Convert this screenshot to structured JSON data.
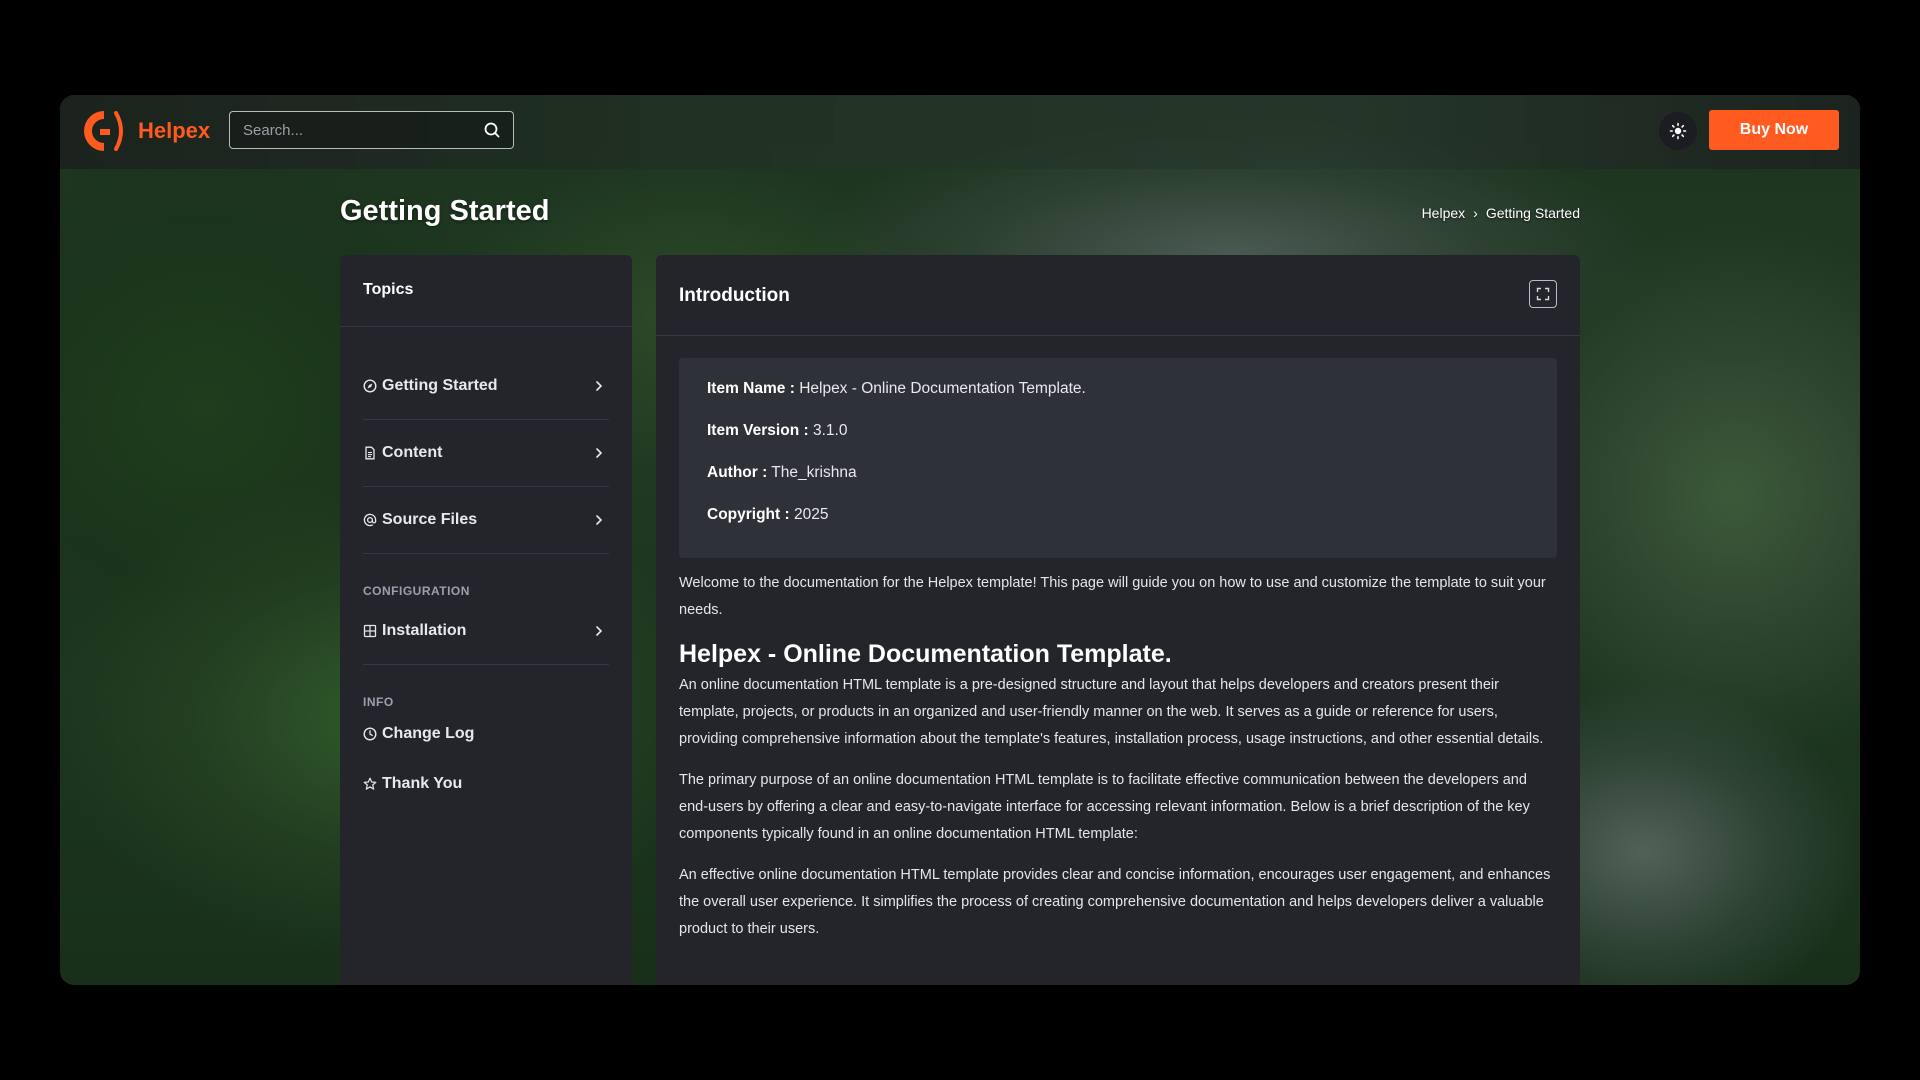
{
  "brand": {
    "name": "Helpex",
    "accent": "#ff5a1f"
  },
  "search": {
    "placeholder": "Search..."
  },
  "header": {
    "buy_label": "Buy Now"
  },
  "page": {
    "title": "Getting Started"
  },
  "breadcrumb": {
    "items": [
      "Helpex",
      "Getting Started"
    ],
    "separator": "›"
  },
  "sidebar": {
    "title": "Topics",
    "items": [
      {
        "label": "Getting Started",
        "icon": "compass-icon"
      },
      {
        "label": "Content",
        "icon": "document-icon"
      },
      {
        "label": "Source Files",
        "icon": "at-icon"
      }
    ],
    "config_label": "CONFIGURATION",
    "config_items": [
      {
        "label": "Installation",
        "icon": "box-icon"
      }
    ],
    "info_label": "INFO",
    "info_items": [
      {
        "label": "Change Log",
        "icon": "clock-icon"
      },
      {
        "label": "Thank You",
        "icon": "star-icon"
      }
    ]
  },
  "main": {
    "title": "Introduction",
    "meta": [
      {
        "key": "Item Name :",
        "value": "Helpex - Online Documentation Template."
      },
      {
        "key": "Item Version :",
        "value": "3.1.0"
      },
      {
        "key": "Author :",
        "value": "The_krishna"
      },
      {
        "key": "Copyright :",
        "value": "2025"
      }
    ],
    "intro": "Welcome to the documentation for the Helpex template! This page will guide you on how to use and customize the template to suit your needs.",
    "heading": "Helpex - Online Documentation Template.",
    "paragraphs": [
      "An online documentation HTML template is a pre-designed structure and layout that helps developers and creators present their template, projects, or products in an organized and user-friendly manner on the web. It serves as a guide or reference for users, providing comprehensive information about the template's features, installation process, usage instructions, and other essential details.",
      "The primary purpose of an online documentation HTML template is to facilitate effective communication between the developers and end-users by offering a clear and easy-to-navigate interface for accessing relevant information. Below is a brief description of the key components typically found in an online documentation HTML template:",
      "An effective online documentation HTML template provides clear and concise information, encourages user engagement, and enhances the overall user experience. It simplifies the process of creating comprehensive documentation and helps developers deliver a valuable product to their users."
    ]
  }
}
